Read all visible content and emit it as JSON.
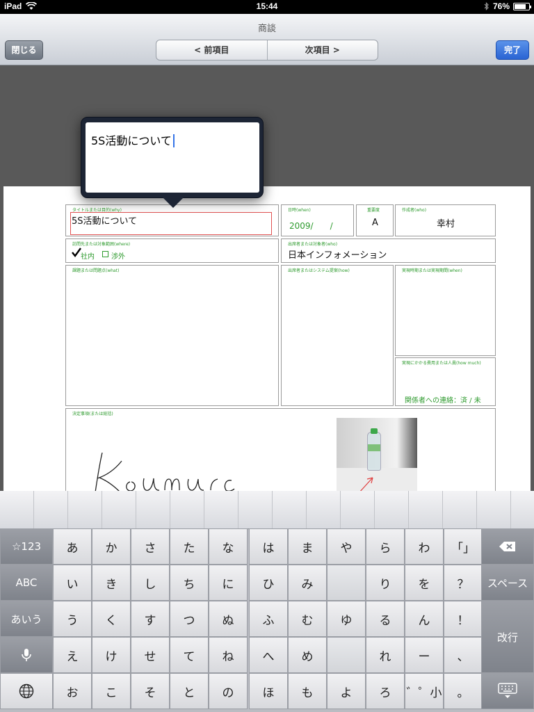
{
  "status": {
    "device": "iPad",
    "time": "15:44",
    "battery": "76%",
    "battery_level": 0.76
  },
  "nav": {
    "title": "商談",
    "close": "閉じる",
    "prev": "< 前項目",
    "next": "次項目 >",
    "done": "完了"
  },
  "form": {
    "title_label": "タイトルまたは目的(why)",
    "title_value": "5S活動について",
    "date_label": "日時(when)",
    "date_value": "2009/　　/",
    "priority_label": "重要度",
    "priority_value": "A",
    "author_label": "作成者(who)",
    "author_value": "幸村",
    "dest_label": "訪問先または対象範囲(where)",
    "dest_opt1": "社内",
    "dest_opt2": "渉外",
    "attendee_label": "出席者または対象者(who)",
    "attendee_value": "日本インフォメーション",
    "issue_label": "課題または問題点(what)",
    "proposal_label": "出席者またはシステム提案(how)",
    "deadline_label": "実現時期または実現期間(when)",
    "cost_label": "実現にかかる費用または人員(how much)",
    "contact_text": "関係者への連絡：済 / 未",
    "decision_label": "決定事項(または総括)"
  },
  "popover": {
    "text": "5S活動について"
  },
  "keyboard": {
    "left": [
      "☆123",
      "ABC",
      "あいう"
    ],
    "cols": [
      [
        "あ",
        "い",
        "う",
        "え",
        "お"
      ],
      [
        "か",
        "き",
        "く",
        "け",
        "こ"
      ],
      [
        "さ",
        "し",
        "す",
        "せ",
        "そ"
      ],
      [
        "た",
        "ち",
        "つ",
        "て",
        "と"
      ],
      [
        "な",
        "に",
        "ぬ",
        "ね",
        "の"
      ],
      [
        "は",
        "ひ",
        "ふ",
        "へ",
        "ほ"
      ],
      [
        "ま",
        "み",
        "む",
        "め",
        "も"
      ],
      [
        "や",
        "",
        "ゆ",
        "",
        "よ"
      ],
      [
        "ら",
        "り",
        "る",
        "れ",
        "ろ"
      ],
      [
        "わ",
        "を",
        "ん",
        "ー",
        "゛゜小"
      ],
      [
        "「」",
        "？",
        "！",
        "、",
        "。"
      ]
    ],
    "space": "スペース",
    "return": "改行"
  }
}
